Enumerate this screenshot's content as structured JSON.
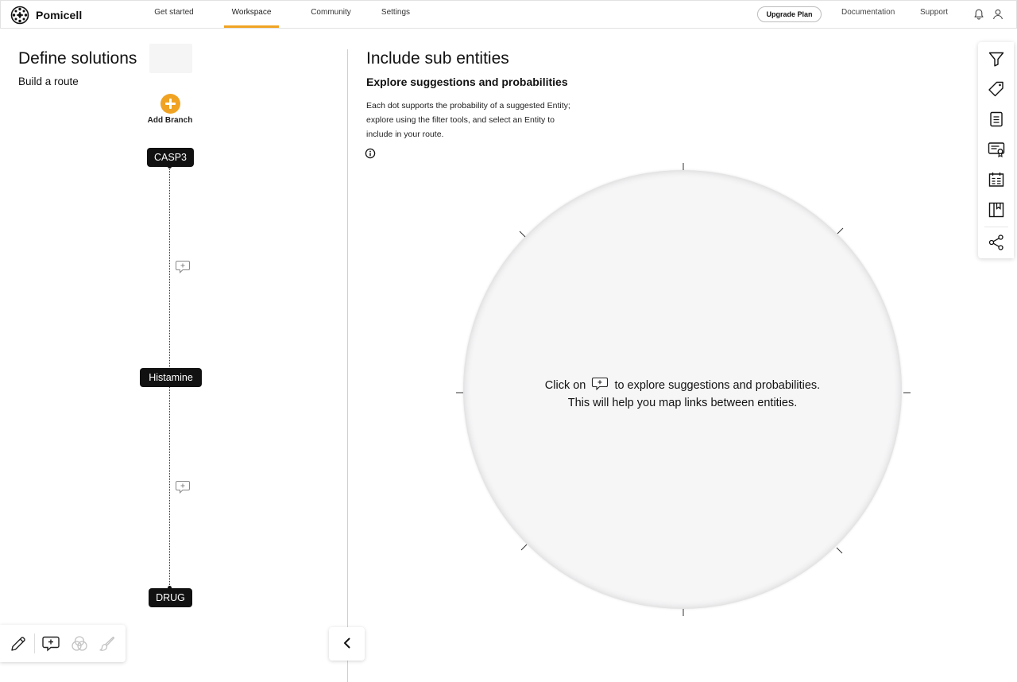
{
  "brand": {
    "name": "Pomicell",
    "logo_icon": "pomicell-logo-icon"
  },
  "nav": {
    "tabs": [
      {
        "label": "Get started",
        "active": false
      },
      {
        "label": "Workspace",
        "active": true
      },
      {
        "label": "Community",
        "active": false
      },
      {
        "label": "Settings",
        "active": false
      }
    ],
    "upgrade_label": "Upgrade Plan",
    "documentation_label": "Documentation",
    "support_label": "Support",
    "icons": [
      "bell-icon",
      "user-icon"
    ]
  },
  "left_panel": {
    "title": "Define solutions",
    "subtitle": "Build a route",
    "add_branch_label": "Add Branch",
    "nodes": [
      {
        "label": "CASP3"
      },
      {
        "label": "Histamine"
      },
      {
        "label": "DRUG"
      }
    ],
    "link_icon": "speech-bubble-plus-icon"
  },
  "bottom_toolbar": {
    "tools": [
      "pencil-icon",
      "speech-bubble-plus-icon",
      "venn-circles-icon",
      "brush-icon"
    ],
    "collapse_icon": "chevron-left-icon"
  },
  "right_panel": {
    "title": "Include sub entities",
    "subtitle": "Explore suggestions and probabilities",
    "description": "Each dot supports the probability of a suggested Entity; explore using the filter tools, and select an Entity to include in your route.",
    "info_icon": "info-icon",
    "message_prefix": "Click on",
    "message_suffix": "to explore suggestions and probabilities.",
    "message_line2": "This will help you map links between entities."
  },
  "right_sidebar": {
    "icons": [
      "filter-icon",
      "tag-icon",
      "document-icon",
      "certificate-icon",
      "report-icon",
      "bookmark-panel-icon",
      "share-icon"
    ]
  },
  "colors": {
    "accent": "#f0a323",
    "node_background": "#111111",
    "radar_fill": "#f6f6f7"
  }
}
